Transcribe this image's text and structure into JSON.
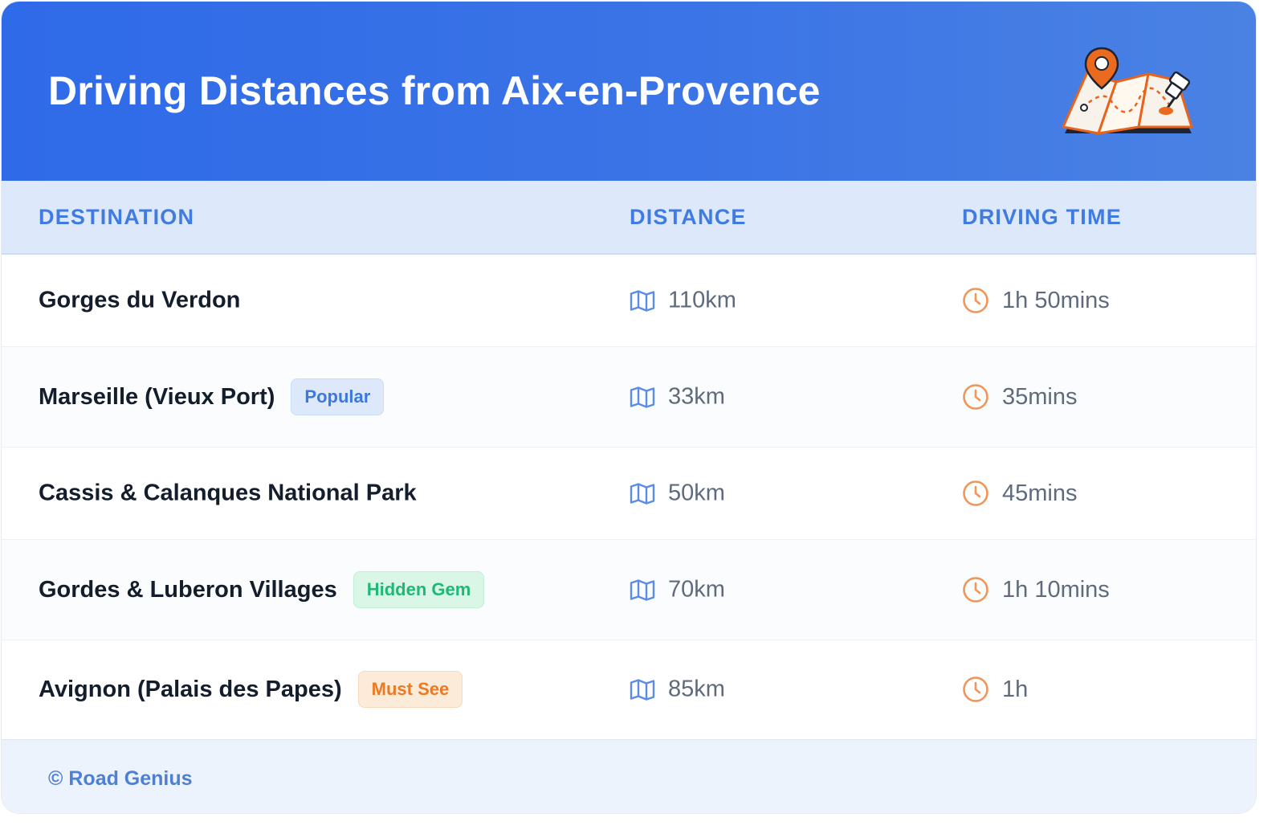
{
  "header": {
    "title": "Driving Distances from Aix-en-Provence",
    "icon": "map-pin-icon"
  },
  "table": {
    "columns": [
      "DESTINATION",
      "DISTANCE",
      "DRIVING TIME"
    ],
    "rows": [
      {
        "destination": "Gorges du Verdon",
        "badge": null,
        "distance": "110km",
        "time": "1h 50mins"
      },
      {
        "destination": "Marseille (Vieux Port)",
        "badge": "Popular",
        "badge_color": "#3d78dc",
        "distance": "33km",
        "time": "35mins"
      },
      {
        "destination": "Cassis & Calanques National Park",
        "badge": null,
        "distance": "50km",
        "time": "45mins"
      },
      {
        "destination": "Gordes & Luberon Villages",
        "badge": "Hidden Gem",
        "badge_color": "#1fb877",
        "distance": "70km",
        "time": "1h 10mins"
      },
      {
        "destination": "Avignon (Palais des Papes)",
        "badge": "Must See",
        "badge_color": "#ea7a24",
        "distance": "85km",
        "time": "1h"
      }
    ],
    "distance_icon": "map-icon",
    "time_icon": "clock-icon"
  },
  "footer": {
    "copyright": "© Road Genius"
  },
  "colors": {
    "header_gradient_start": "#2f6ae8",
    "header_gradient_end": "#4a82e3",
    "accent": "#3f7be0",
    "clock": "#f0955a"
  }
}
